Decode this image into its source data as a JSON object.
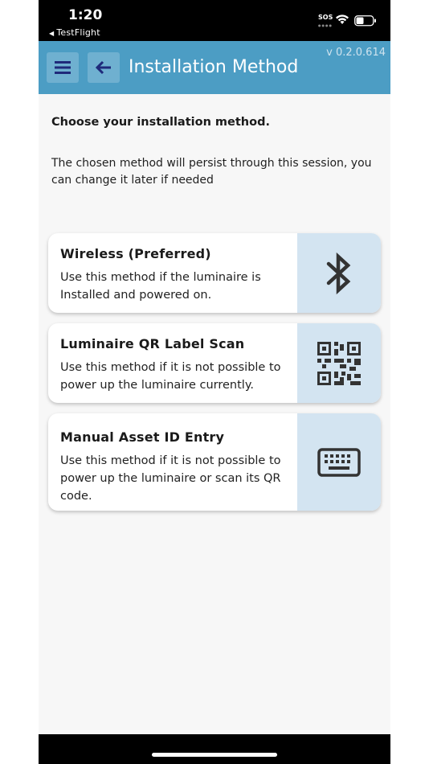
{
  "status_bar": {
    "time": "1:20",
    "back_app": "TestFlight",
    "sos": "SOS"
  },
  "header": {
    "title": "Installation Method",
    "version": "v 0.2.0.614",
    "menu_icon": "hamburger-menu-icon",
    "back_icon": "arrow-left-icon"
  },
  "content": {
    "heading": "Choose your installation method.",
    "description": "The chosen method will persist through this session, you can change it later if needed"
  },
  "methods": [
    {
      "title": "Wireless (Preferred)",
      "description": "Use this method if the luminaire is Installed and powered on.",
      "icon": "bluetooth-icon"
    },
    {
      "title": "Luminaire QR Label Scan",
      "description": "Use this method if it is not possible to power up the luminaire currently.",
      "icon": "qr-code-icon"
    },
    {
      "title": "Manual Asset ID Entry",
      "description": "Use this method if it is not possible to power up the luminaire or scan its QR code.",
      "icon": "keyboard-icon"
    }
  ],
  "colors": {
    "header_bg": "#4c9dc4",
    "header_button_bg": "#6fb0d0",
    "icon_panel_bg": "#d3e4f1",
    "icon_color": "#333333",
    "menu_icon_color": "#1f2a7a"
  }
}
